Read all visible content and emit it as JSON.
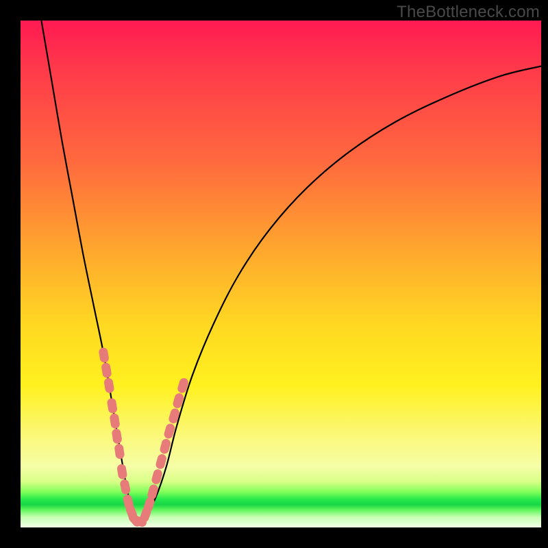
{
  "watermark": "TheBottleneck.com",
  "chart_data": {
    "type": "line",
    "title": "",
    "xlabel": "",
    "ylabel": "",
    "xlim": [
      0,
      100
    ],
    "ylim": [
      0,
      100
    ],
    "series": [
      {
        "name": "bottleneck-curve",
        "x": [
          4,
          6,
          8,
          10,
          12,
          14,
          16,
          18,
          19,
          20,
          21,
          22,
          23,
          24,
          26,
          28,
          30,
          33,
          37,
          42,
          48,
          55,
          63,
          72,
          82,
          92,
          100
        ],
        "y": [
          100,
          88,
          76,
          65,
          54,
          44,
          34,
          22,
          16,
          10,
          5,
          2,
          1,
          2,
          6,
          12,
          20,
          30,
          40,
          50,
          59,
          67,
          74,
          80,
          85,
          89,
          91
        ]
      }
    ],
    "markers": {
      "name": "highlight-beads",
      "color": "#e77b79",
      "segments": [
        {
          "points": [
            {
              "x": 16.0,
              "y": 34
            },
            {
              "x": 16.5,
              "y": 31
            },
            {
              "x": 17.0,
              "y": 28
            },
            {
              "x": 17.6,
              "y": 24
            },
            {
              "x": 18.1,
              "y": 21
            },
            {
              "x": 18.5,
              "y": 18
            },
            {
              "x": 19.0,
              "y": 15
            },
            {
              "x": 19.5,
              "y": 11
            },
            {
              "x": 20.1,
              "y": 8
            },
            {
              "x": 20.7,
              "y": 5
            },
            {
              "x": 21.3,
              "y": 3
            },
            {
              "x": 22.0,
              "y": 1.5
            },
            {
              "x": 22.8,
              "y": 1.2
            }
          ]
        },
        {
          "points": [
            {
              "x": 24.0,
              "y": 2.5
            },
            {
              "x": 24.7,
              "y": 4.5
            },
            {
              "x": 25.4,
              "y": 7
            },
            {
              "x": 26.2,
              "y": 10
            },
            {
              "x": 27.0,
              "y": 13
            },
            {
              "x": 27.8,
              "y": 16
            },
            {
              "x": 28.6,
              "y": 19
            },
            {
              "x": 29.5,
              "y": 22
            },
            {
              "x": 30.3,
              "y": 25
            },
            {
              "x": 31.2,
              "y": 28
            }
          ]
        }
      ]
    }
  }
}
